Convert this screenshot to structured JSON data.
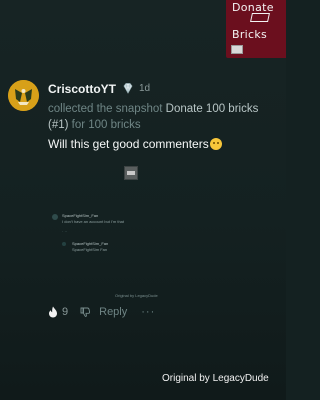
{
  "snapshot_card": {
    "line1": "Donate",
    "line2": "Bricks"
  },
  "post": {
    "username": "CriscottoYT",
    "time": "1d",
    "action_prefix": "collected the snapshot ",
    "snapshot_title": "Donate 100 bricks (#1)",
    "action_suffix": " for 100 bricks",
    "comment": "Will this get good commenters"
  },
  "nested": {
    "comment1_user": "SpaceFightSim_Fan",
    "comment1_text": "I don't have an account but I'm that",
    "reply_user": "SpaceFightSim_Fan",
    "reply_text": "SpaceFightSim Fan",
    "footer": "Original by LegacyDude"
  },
  "actions": {
    "like_count": "9",
    "reply_label": "Reply",
    "more_label": "···"
  },
  "credit": "Original by LegacyDude",
  "colors": {
    "background": "#142121",
    "snapshot_bg": "#6b0f1e",
    "avatar": "#d7a019"
  }
}
